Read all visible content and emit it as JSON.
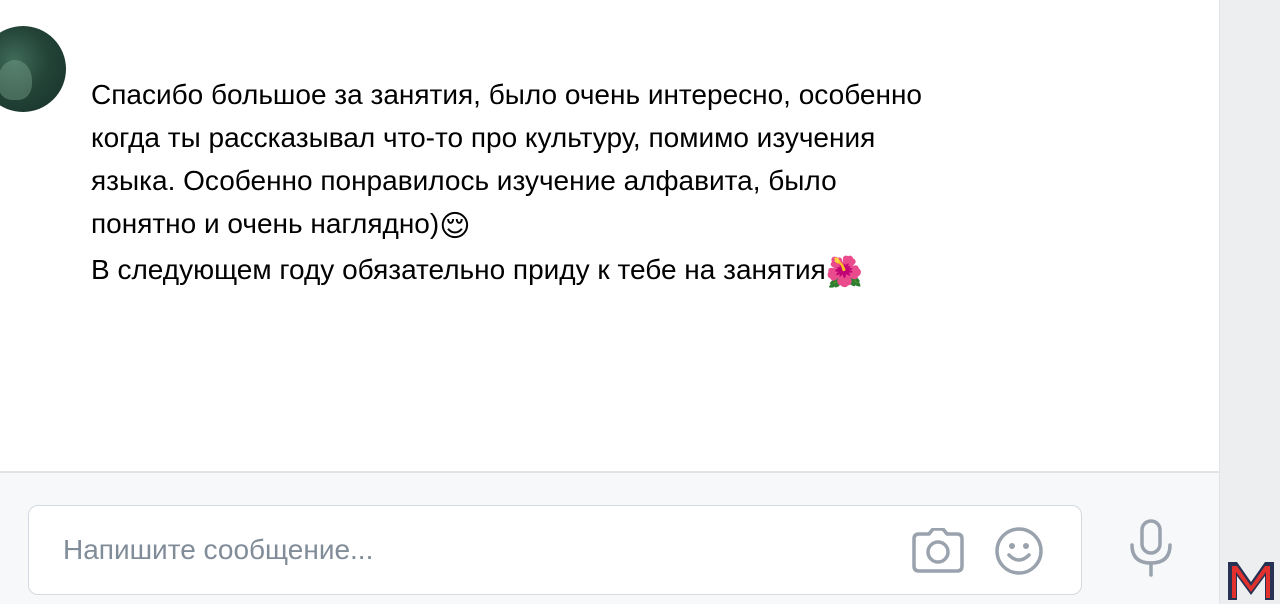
{
  "message": {
    "lines": [
      "Спасибо большое за занятия, было очень интересно, особенно",
      "когда ты рассказывал что-то про культуру, помимо изучения",
      "языка. Особенно понравилось изучение алфавита, было",
      "понятно и очень наглядно)",
      "В следующем году обязательно приду к тебе на занятия"
    ],
    "emoji_relieved": "😌",
    "emoji_flower": "🌺"
  },
  "composer": {
    "placeholder": "Напишите сообщение..."
  },
  "icons": {
    "camera": "camera-icon",
    "smile": "smile-icon",
    "mic": "microphone-icon",
    "logo": "m-logo"
  },
  "colors": {
    "icon_gray": "#99a2ad",
    "placeholder_gray": "#818c99",
    "logo_red": "#e2312d",
    "logo_navy": "#263153"
  }
}
